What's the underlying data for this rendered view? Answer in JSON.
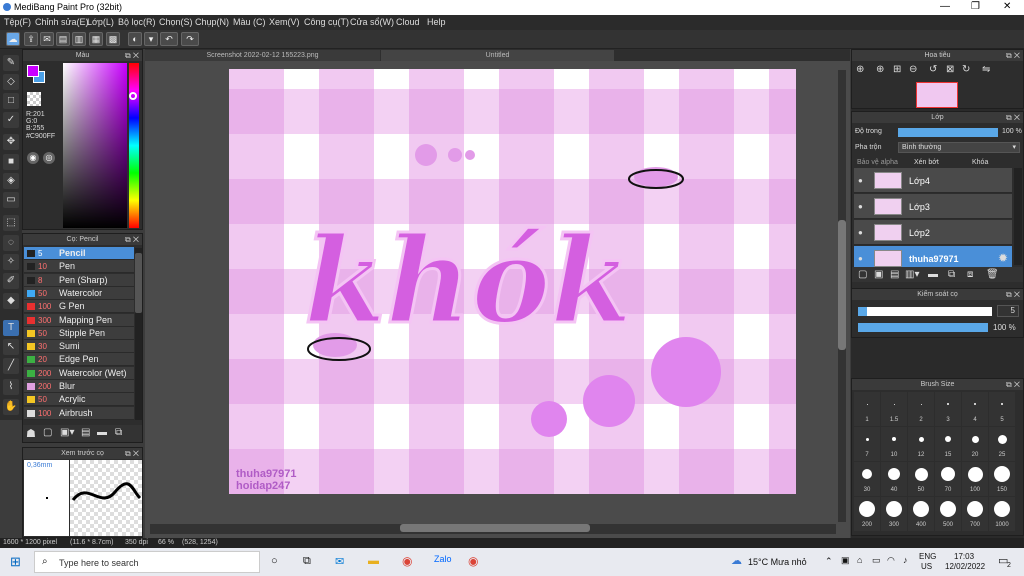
{
  "window": {
    "title": "MediBang Paint Pro (32bit)",
    "min": "—",
    "max": "❐",
    "close": "✕"
  },
  "menu": [
    "Tệp(F)",
    "Chỉnh sửa(E)",
    "Lớp(L)",
    "Bộ lọc(R)",
    "Chọn(S)",
    "Chụp(N)",
    "Màu (C)",
    "Xem(V)",
    "Công cụ(T)",
    "Cửa sổ(W)",
    "Cloud",
    "Help"
  ],
  "color_panel": {
    "title": "Màu",
    "r": "R:201",
    "g": "G:0",
    "b": "B:255",
    "hex": "#C900FF",
    "fg": "#c900ff",
    "bg": "#4aa0e8"
  },
  "brush_panel": {
    "title": "Cọ: Pencil",
    "items": [
      {
        "size": "5",
        "name": "Pencil",
        "color": "#222222"
      },
      {
        "size": "10",
        "name": "Pen",
        "color": "#222222"
      },
      {
        "size": "8",
        "name": "Pen (Sharp)",
        "color": "#222222"
      },
      {
        "size": "50",
        "name": "Watercolor",
        "color": "#3fa9f5"
      },
      {
        "size": "100",
        "name": "G Pen",
        "color": "#e83030"
      },
      {
        "size": "300",
        "name": "Mapping Pen",
        "color": "#e83030"
      },
      {
        "size": "50",
        "name": "Stipple Pen",
        "color": "#f3c623"
      },
      {
        "size": "30",
        "name": "Sumi",
        "color": "#f3c623"
      },
      {
        "size": "20",
        "name": "Edge Pen",
        "color": "#3cb043"
      },
      {
        "size": "200",
        "name": "Watercolor (Wet)",
        "color": "#3cb043"
      },
      {
        "size": "200",
        "name": "Blur",
        "color": "#e0a0e0"
      },
      {
        "size": "50",
        "name": "Acrylic",
        "color": "#f3c623"
      },
      {
        "size": "100",
        "name": "Airbrush",
        "color": "#dddddd"
      }
    ]
  },
  "preview_panel": {
    "title": "Xem trước cọ",
    "size": "0,36mm"
  },
  "tabs": [
    "Screenshot 2022-02-12 155223.png",
    "Untitled"
  ],
  "artwork": {
    "text": "khók",
    "sign1": "thuha97971",
    "sign2": "hoidap247"
  },
  "navigator": {
    "title": "Hoa tiêu"
  },
  "layer_panel": {
    "title": "Lớp",
    "opacity_label": "Độ trong",
    "opacity_value": "100 %",
    "blend_label": "Pha trộn",
    "blend_value": "Bình thường",
    "protect_alpha": "Bảo vệ alpha",
    "clip": "Xén bớt",
    "lock": "Khóa",
    "layers": [
      "Lớp4",
      "Lớp3",
      "Lớp2",
      "thuha97971"
    ]
  },
  "brush_control": {
    "title": "Kiểm soát cọ",
    "size": "5",
    "opacity": "100 %"
  },
  "brush_size": {
    "title": "Brush Size",
    "labels": [
      "1",
      "1.5",
      "2",
      "3",
      "4",
      "5",
      "7",
      "10",
      "12",
      "15",
      "20",
      "25",
      "30",
      "40",
      "50",
      "70",
      "100",
      "150",
      "200",
      "300",
      "400",
      "500",
      "700",
      "1000"
    ]
  },
  "status": {
    "dims": "1600 * 1200 pixel",
    "cm": "(11.6 * 8.7cm)",
    "dpi": "350 dpi",
    "zoom": "66 %",
    "coords": "(528, 1254)"
  },
  "taskbar": {
    "search": "Type here to search",
    "weather": "15°C  Mưa nhỏ",
    "lang1": "ENG",
    "lang2": "US",
    "time": "17:03",
    "date": "12/02/2022",
    "notif": "2"
  }
}
